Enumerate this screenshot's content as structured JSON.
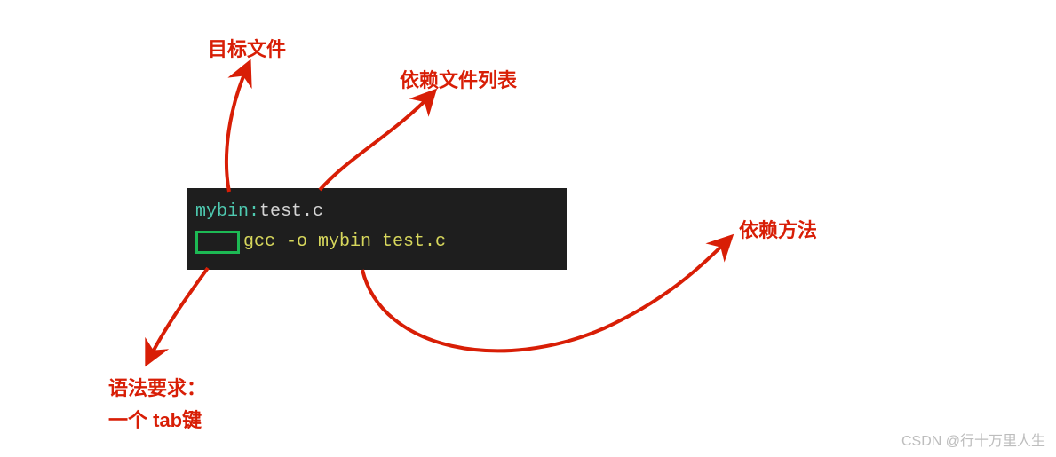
{
  "labels": {
    "target_file": "目标文件",
    "dep_list": "依赖文件列表",
    "dep_method": "依赖方法",
    "syntax_req_line1": "语法要求：",
    "syntax_req_line2": "一个 tab键"
  },
  "code": {
    "target": "mybin",
    "separator": ":",
    "deps": "test.c",
    "command": "gcc -o mybin test.c"
  },
  "watermark": "CSDN @行十万里人生"
}
